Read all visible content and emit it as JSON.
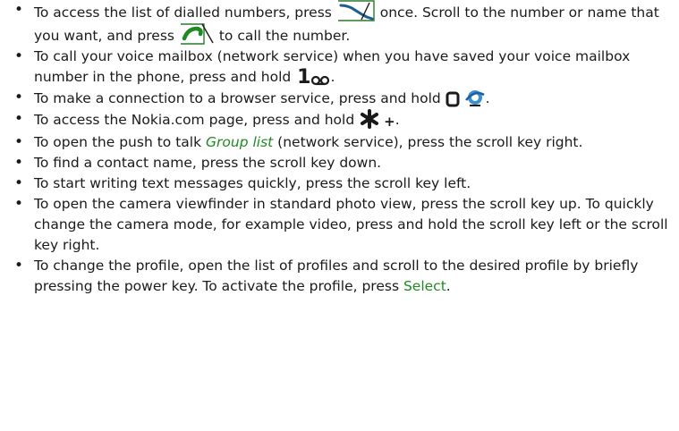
{
  "tips": [
    {
      "parts": [
        "To access the list of dialled numbers, press",
        "once. Scroll to the number or name that you want, and press",
        "to call the number."
      ]
    },
    {
      "parts": [
        "To call your voice mailbox (network service) when you have saved your voice mailbox number in the phone, press and hold",
        "1",
        "σσ",
        "."
      ]
    },
    {
      "parts": [
        "To make a connection to a browser service, press and hold",
        "0",
        "."
      ]
    },
    {
      "parts": [
        "To access the Nokia.com page, press and hold",
        "*",
        "+",
        "."
      ]
    },
    {
      "parts": [
        "To open the push to talk",
        "Group list",
        "(network service), press the scroll key right."
      ]
    },
    {
      "text": "To find a contact name, press the scroll key down."
    },
    {
      "text": "To start writing text messages quickly, press the scroll key left."
    },
    {
      "text": "To open the camera viewfinder in standard photo view, press the scroll key up. To quickly change the camera mode, for example video, press and hold the scroll key left or the scroll key right."
    },
    {
      "parts": [
        "To change the profile, open the list of profiles and scroll to the desired profile by briefly pressing the power key. To activate the profile, press",
        "Select",
        "."
      ]
    }
  ],
  "icons": {
    "end_key": "end-key-icon",
    "call_key": "call-key-icon",
    "browser": "browser-icon"
  },
  "colors": {
    "accent_green": "#1f8a22",
    "text": "#1a1a1a"
  }
}
